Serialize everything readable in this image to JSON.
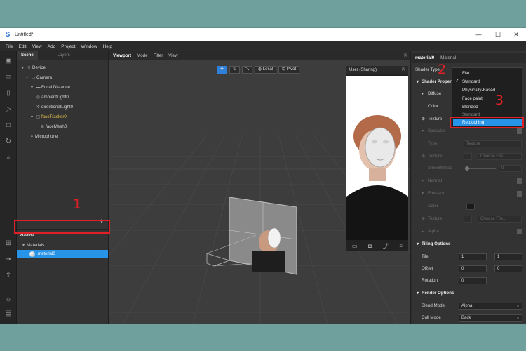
{
  "app": {
    "title": "Untitled*",
    "window_controls": [
      "—",
      "☐",
      "✕"
    ]
  },
  "menu": [
    "File",
    "Edit",
    "View",
    "Add",
    "Project",
    "Window",
    "Help"
  ],
  "scene_panel": {
    "tabs": [
      "Scene",
      "Layers"
    ],
    "tree": [
      {
        "label": "Device",
        "icon": "device-icon"
      },
      {
        "label": "Camera",
        "icon": "camera-icon"
      },
      {
        "label": "Focal Distance",
        "icon": "focal-icon"
      },
      {
        "label": "ambientLight0",
        "icon": "light-icon"
      },
      {
        "label": "directionalLight0",
        "icon": "directional-light-icon"
      },
      {
        "label": "faceTracker0",
        "icon": "face-tracker-icon"
      },
      {
        "label": "faceMesh0",
        "icon": "mesh-icon"
      },
      {
        "label": "Microphone",
        "icon": "microphone-icon"
      }
    ],
    "add_symbol": "+"
  },
  "assets": {
    "title": "Assets",
    "folder": "Materials",
    "selected_item": "material0"
  },
  "viewport": {
    "tabs": [
      "Viewport",
      "Mode",
      "Filter",
      "View"
    ],
    "local_label": "Local",
    "pivot_label": "Pivot",
    "preview_label": "User (Sharing)"
  },
  "inspector": {
    "header_name": "material0",
    "header_type": "– Material",
    "shader_type_label": "Shader Type",
    "shader_properties": "Shader Propert",
    "diffuse": "Diffuse",
    "color": "Color",
    "texture": "Texture",
    "specular": "Specular",
    "type": "Type",
    "type_value": "Texture",
    "texture2": "Texture",
    "choose_file": "Choose File...",
    "smoothness": "Smoothness",
    "smoothness_value": "0",
    "normal": "Normal",
    "emission": "Emission",
    "color2": "Color",
    "texture3": "Texture",
    "choose_file2": "Choose File...",
    "alpha": "Alpha",
    "tiling_options": "Tiling Options",
    "tile": "Tile",
    "tile_x": "1",
    "tile_y": "1",
    "offset": "Offset",
    "offset_x": "0",
    "offset_y": "0",
    "rotation": "Rotation",
    "rotation_value": "0",
    "render_options": "Render Options",
    "blend_mode": "Blend Mode",
    "blend_mode_value": "Alpha",
    "cull_mode": "Cull Mode",
    "cull_mode_value": "Back"
  },
  "shader_dropdown": {
    "items": [
      "Flat",
      "Standard",
      "Physically-Based",
      "Face paint",
      "Blended",
      "Standard"
    ],
    "checked_index": 1,
    "selected": "Retouching"
  },
  "annotations": [
    "1",
    "2",
    "3"
  ],
  "colors": {
    "accent": "#2794e8",
    "highlight_box": "#e01f26",
    "background": "#6fa09e"
  }
}
